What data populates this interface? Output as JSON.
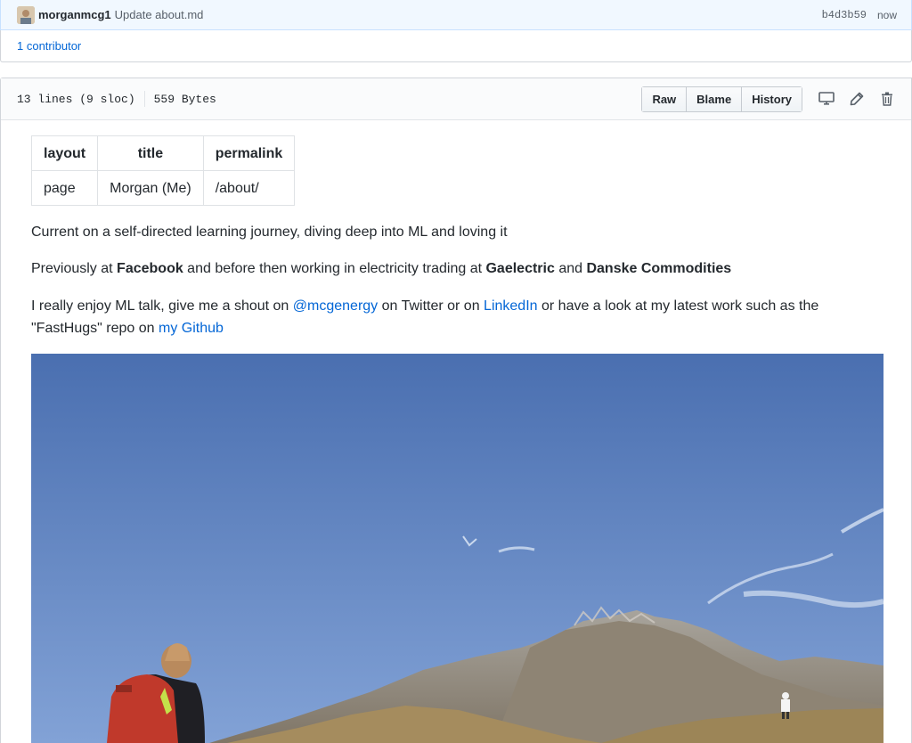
{
  "commit": {
    "author": "morganmcg1",
    "message": "Update about.md",
    "sha": "b4d3b59",
    "time": "now"
  },
  "contributors": {
    "text": "1 contributor"
  },
  "file_header": {
    "lines": "13 lines (9 sloc)",
    "size": "559 Bytes",
    "buttons": [
      "Raw",
      "Blame",
      "History"
    ],
    "icons": [
      "desktop-icon",
      "pencil-icon",
      "trash-icon"
    ]
  },
  "front_matter": {
    "headers": [
      "layout",
      "title",
      "permalink"
    ],
    "values": [
      "page",
      "Morgan (Me)",
      "/about/"
    ]
  },
  "content": {
    "p1": "Current on a self-directed learning journey, diving deep into ML and loving it",
    "p2_prefix": "Previously at ",
    "p2_facebook": "Facebook",
    "p2_middle": " and before then working in electricity trading at ",
    "p2_gaelectric": "Gaelectric",
    "p2_and": " and ",
    "p2_danske": "Danske Commodities",
    "p3_prefix": "I really enjoy ML talk, give me a shout on ",
    "p3_twitter_link": "@mcgenergy",
    "p3_mid1": " on Twitter or on ",
    "p3_linkedin_link": "LinkedIn",
    "p3_mid2": " or have a look at my latest work such as the \"FastHugs\" repo on ",
    "p3_github_link": "my Github"
  },
  "colors": {
    "link": "#0366d6",
    "sky_top": "#4a6fb0",
    "sky_bottom": "#7d9ed4"
  }
}
